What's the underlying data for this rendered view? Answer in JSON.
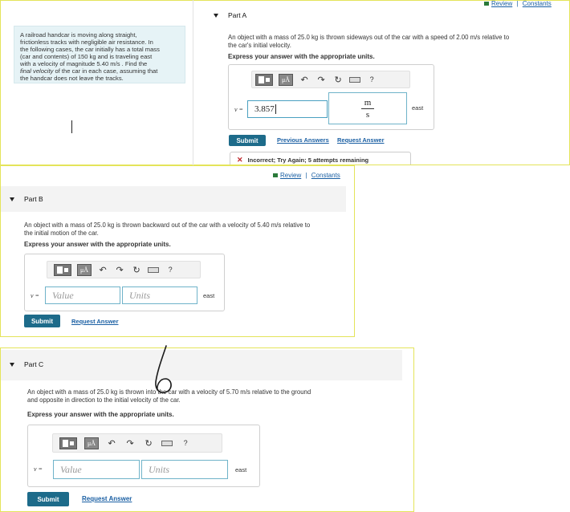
{
  "top_links": {
    "review": "Review",
    "sep": "|",
    "constants": "Constants"
  },
  "problem": {
    "lines": [
      "A railroad handcar is moving along straight,",
      "frictionless tracks with negligible air resistance. In",
      "the following cases, the car initially has a total mass",
      "(car and contents) of 150 kg and is traveling east",
      "with a velocity of magnitude 5.40 m/s . Find the"
    ],
    "italic_line_a": "final velocity",
    "line6_rest": " of the car in each case, assuming that",
    "line7": "the handcar does not leave the tracks."
  },
  "toolbar_symbols": {
    "mu": "μÅ",
    "undo": "↶",
    "redo": "↷",
    "reset": "↻",
    "help": "?"
  },
  "partA": {
    "title": "Part A",
    "question_l1": "An object with a mass of 25.0 kg is thrown sideways out of the car with a speed of 2.00 m/s relative to",
    "question_l2": "the car's initial velocity.",
    "instruction": "Express your answer with the appropriate units.",
    "var_label": "v =",
    "value": "3.857",
    "unit_num": "m",
    "unit_den": "s",
    "direction": "east",
    "submit": "Submit",
    "prev_answers": "Previous Answers",
    "request_answer": "Request Answer",
    "feedback": "Incorrect; Try Again; 5 attempts remaining"
  },
  "partB": {
    "links": {
      "review": "Review",
      "sep": "|",
      "constants": "Constants"
    },
    "title": "Part B",
    "question_l1": "An object with a mass of 25.0 kg is thrown backward out of the car with a velocity of 5.40 m/s relative to",
    "question_l2": "the initial motion of the car.",
    "instruction": "Express your answer with the appropriate units.",
    "var_label": "v =",
    "value_placeholder": "Value",
    "units_placeholder": "Units",
    "direction": "east",
    "submit": "Submit",
    "request_answer": "Request Answer"
  },
  "partC": {
    "title": "Part C",
    "question_l1": "An object with a mass of 25.0 kg is thrown into the car with a velocity of 5.70 m/s relative to the ground",
    "question_l2": "and opposite in direction to the initial velocity of the car.",
    "instruction": "Express your answer with the appropriate units.",
    "var_label": "v =",
    "value_placeholder": "Value",
    "units_placeholder": "Units",
    "direction": "east",
    "submit": "Submit",
    "request_answer": "Request Answer"
  },
  "colors": {
    "accent": "#1d6b8a",
    "link": "#1a5fa3",
    "field_border": "#6fb3c9",
    "panel_border": "#e4e45a",
    "error": "#c0262b"
  }
}
